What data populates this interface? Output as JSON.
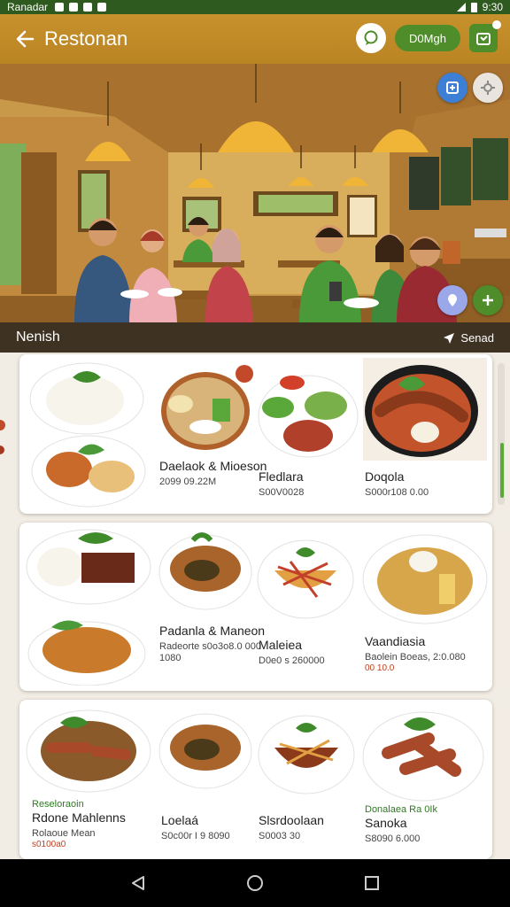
{
  "status_bar": {
    "carrier": "Ranadar",
    "time": "9:30"
  },
  "app_bar": {
    "title": "Restonan",
    "pill_label": "D0Mgh"
  },
  "section": {
    "title": "Nenish",
    "action_label": "Senad"
  },
  "cards": [
    {
      "items": [
        {
          "name": "",
          "price": ""
        },
        {
          "name": "Daelaok & Mioeson",
          "price": "2099 09.22M"
        },
        {
          "name": "Fledlara",
          "price": "S00V0028"
        },
        {
          "name": "Doqola",
          "price": "S000r108 0.00"
        }
      ]
    },
    {
      "items": [
        {
          "name": "",
          "price": ""
        },
        {
          "name": "Padanla & Maneon",
          "price": "Radeorte s0o3o8.0 000 1080"
        },
        {
          "name": "Maleiea",
          "price": "D0e0 s 260000"
        },
        {
          "name": "Vaandiasia",
          "price": "Baolein Boeas, 2:0.080",
          "extra": "00 10.0"
        }
      ]
    },
    {
      "items": [
        {
          "tag": "Reseloraoin",
          "name": "Rdone Mahlenns",
          "price": "Rolaoue Mean",
          "extra": "s0100a0"
        },
        {
          "name": "Loelaá",
          "price": "S0c00r I 9 8090"
        },
        {
          "name": "Slsrdoolaan",
          "price": "S0003 30"
        },
        {
          "tag": "Donalaea Ra 0Ik",
          "name": "Sanoka",
          "price": "S8090 6.000"
        }
      ]
    }
  ],
  "colors": {
    "brand_green": "#4e8d2a",
    "app_bar": "#c7912d",
    "section_bar": "#3e3323"
  },
  "icons": [
    "back-arrow-icon",
    "chat-icon",
    "cart-icon",
    "hero-action-icons",
    "send-icon",
    "back-triangle-icon",
    "home-circle-icon",
    "recents-square-icon"
  ]
}
